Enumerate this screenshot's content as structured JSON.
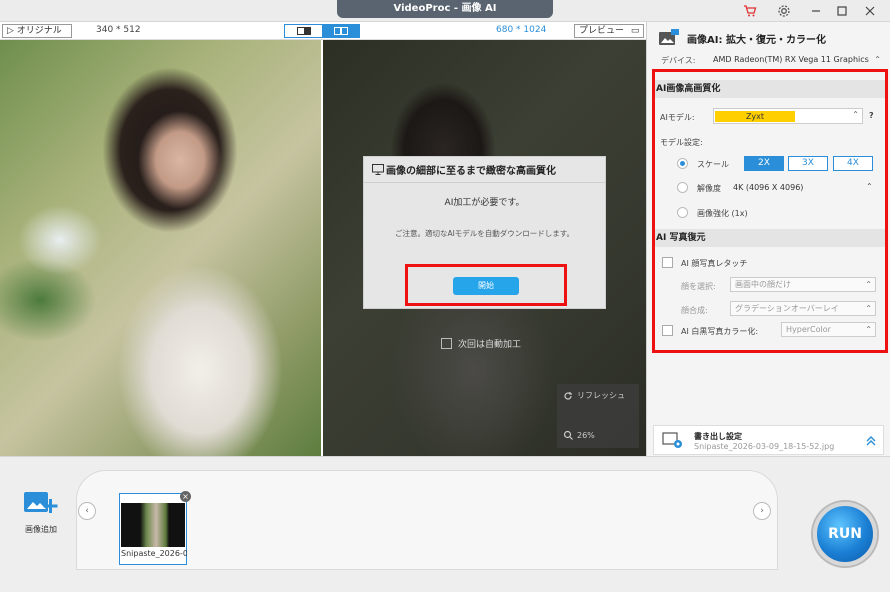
{
  "window": {
    "title": "VideoProc - 画像 AI"
  },
  "preview": {
    "original_label": "オリジナル",
    "original_dims": "340 * 512",
    "preview_label": "プレビュー",
    "preview_dims": "680 * 1024"
  },
  "modal": {
    "title": "画像の細部に至るまで緻密な高画質化",
    "message": "AI加工が必要です。",
    "note": "ご注意。適切なAIモデルを自動ダウンロードします。",
    "start_label": "開始"
  },
  "auto_process": {
    "label": "次回は自動加工"
  },
  "refresh": {
    "label": "リフレッシュ",
    "zoom": "26%"
  },
  "panel": {
    "title": "画像AI: 拡大・復元・カラー化",
    "device_label": "デバイス:",
    "device_value": "AMD Radeon(TM) RX Vega 11 Graphics",
    "upscale_section": "AI画像高画質化",
    "model_label": "AIモデル:",
    "model_value": "Zyxt",
    "model_help": "?",
    "settings_label": "モデル設定:",
    "scale_label": "スケール",
    "scale_options": [
      "2X",
      "3X",
      "4X"
    ],
    "resolution_label": "解像度",
    "resolution_value": "4K (4096 X 4096)",
    "enhance_label": "画像強化 (1x)",
    "restore_section": "AI 写真復元",
    "retouch_label": "AI 顔写真レタッチ",
    "face_select_label": "顔を選択:",
    "face_select_value": "画面中の顔だけ",
    "face_blend_label": "顔合成:",
    "face_blend_value": "グラデーションオーバーレイ",
    "colorize_label": "AI 白黒写真カラー化:",
    "colorize_value": "HyperColor"
  },
  "export": {
    "title": "書き出し設定",
    "filename": "Snipaste_2026-03-09_18-15-52.jpg"
  },
  "bottom": {
    "add_image_label": "画像追加",
    "thumb_name": "Snipaste_2026-0",
    "run_label": "RUN"
  },
  "colors": {
    "accent": "#2a8fd8",
    "highlight": "#ee1111",
    "model_badge": "#ffcf00"
  }
}
